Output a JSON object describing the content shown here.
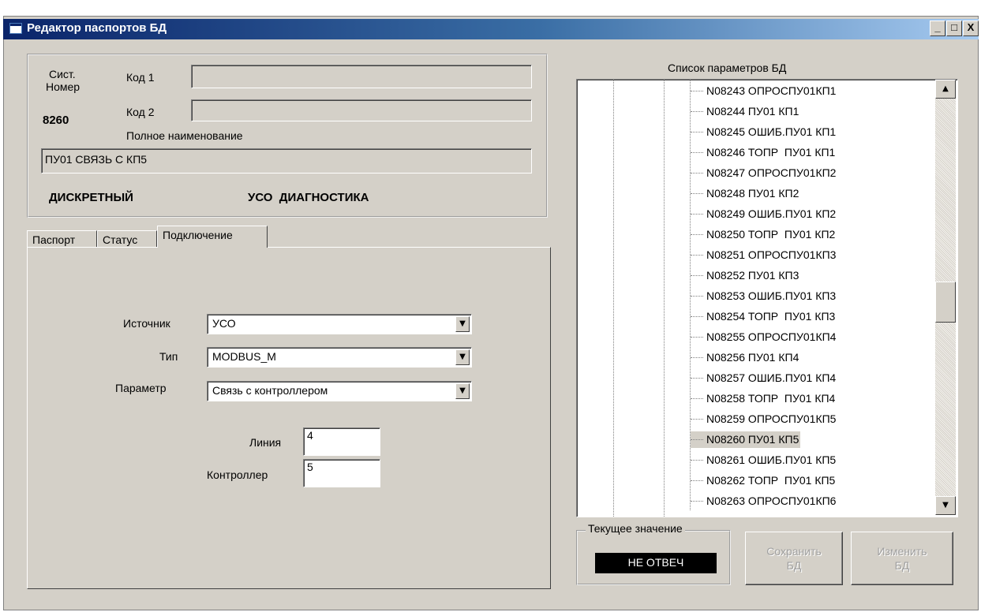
{
  "window": {
    "title": "Редактор паспортов БД",
    "min_label": "_",
    "max_label": "□",
    "close_label": "X"
  },
  "info": {
    "sys_label_line1": "Сист.",
    "sys_label_line2": "Номер",
    "sys_number": "8260",
    "code1_label": "Код 1",
    "code1_value": "",
    "code2_label": "Код 2",
    "code2_value": "",
    "fullname_label": "Полное наименование",
    "fullname_value": "ПУ01 СВЯЗЬ С КП5",
    "kind": "ДИСКРЕТНЫЙ",
    "category": "УСО  ДИАГНОСТИКА"
  },
  "tabs": [
    {
      "label": "Паспорт",
      "active": false
    },
    {
      "label": "Статус",
      "active": false
    },
    {
      "label": "Подключение",
      "active": true
    }
  ],
  "connection": {
    "source_label": "Источник",
    "source_value": "УСО",
    "type_label": "Тип",
    "type_value": "MODBUS_M",
    "param_label": "Параметр",
    "param_value": "Связь с контроллером",
    "line_label": "Линия",
    "line_value": "4",
    "controller_label": "Контроллер",
    "controller_value": "5"
  },
  "param_list": {
    "title": "Список параметров БД",
    "selected": "N08260 ПУ01 КП5",
    "items": [
      "N08243 ОПРОСПУ01КП1",
      "N08244 ПУ01 КП1",
      "N08245 ОШИБ.ПУ01 КП1",
      "N08246 ТОПР  ПУ01 КП1",
      "N08247 ОПРОСПУ01КП2",
      "N08248 ПУ01 КП2",
      "N08249 ОШИБ.ПУ01 КП2",
      "N08250 ТОПР  ПУ01 КП2",
      "N08251 ОПРОСПУ01КП3",
      "N08252 ПУ01 КП3",
      "N08253 ОШИБ.ПУ01 КП3",
      "N08254 ТОПР  ПУ01 КП3",
      "N08255 ОПРОСПУ01КП4",
      "N08256 ПУ01 КП4",
      "N08257 ОШИБ.ПУ01 КП4",
      "N08258 ТОПР  ПУ01 КП4",
      "N08259 ОПРОСПУ01КП5",
      "N08260 ПУ01 КП5",
      "N08261 ОШИБ.ПУ01 КП5",
      "N08262 ТОПР  ПУ01 КП5",
      "N08263 ОПРОСПУ01КП6"
    ],
    "scroll_up_icon": "triangle-up-icon",
    "scroll_down_icon": "triangle-down-icon"
  },
  "current_value": {
    "label": "Текущее значение",
    "value": "НЕ ОТВЕЧ"
  },
  "buttons": {
    "save_line1": "Сохранить",
    "save_line2": "БД",
    "edit_line1": "Изменить",
    "edit_line2": "БД"
  },
  "colors": {
    "title_bar": "#0a246a",
    "face": "#d4d0c8",
    "display_bg": "#000000",
    "display_fg": "#ffffff"
  }
}
